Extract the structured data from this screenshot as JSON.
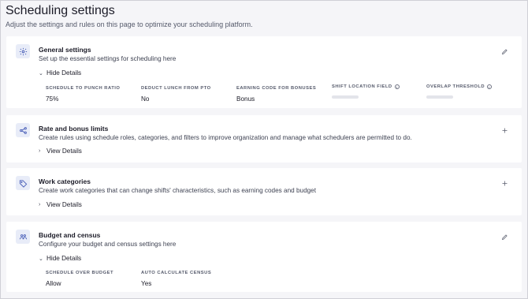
{
  "header": {
    "title": "Scheduling settings",
    "subtitle": "Adjust the settings and rules on this page to optimize your scheduling platform."
  },
  "sections": [
    {
      "title": "General settings",
      "description": "Set up the essential settings for scheduling here",
      "icon": "gear-icon",
      "action_icon": "pencil-icon",
      "toggle_label": "Hide Details",
      "expanded": true,
      "fields": [
        {
          "label": "SCHEDULE TO PUNCH RATIO",
          "value": "75%"
        },
        {
          "label": "DEDUCT LUNCH FROM PTO",
          "value": "No"
        },
        {
          "label": "EARNING CODE FOR BONUSES",
          "value": "Bonus"
        },
        {
          "label": "SHIFT LOCATION FIELD",
          "value": "",
          "info": true,
          "loading": true
        },
        {
          "label": "OVERLAP THRESHOLD",
          "value": "",
          "info": true,
          "loading": true
        }
      ]
    },
    {
      "title": "Rate and bonus limits",
      "description": "Create rules using schedule roles, categories, and filters to improve organization and manage what schedulers are permitted to do.",
      "icon": "share-nodes-icon",
      "action_icon": "plus-icon",
      "toggle_label": "View Details",
      "expanded": false
    },
    {
      "title": "Work categories",
      "description": "Create work categories that can change shifts' characteristics, such as earning codes and budget",
      "icon": "tag-icon",
      "action_icon": "plus-icon",
      "toggle_label": "View Details",
      "expanded": false
    },
    {
      "title": "Budget and census",
      "description": "Configure your budget and census settings here",
      "icon": "people-icon",
      "action_icon": "pencil-icon",
      "toggle_label": "Hide Details",
      "expanded": true,
      "fields": [
        {
          "label": "SCHEDULE OVER BUDGET",
          "value": "Allow"
        },
        {
          "label": "AUTO CALCULATE CENSUS",
          "value": "Yes"
        }
      ]
    }
  ]
}
